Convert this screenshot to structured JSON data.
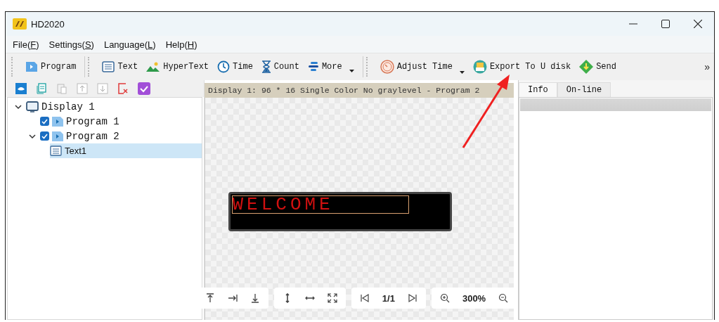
{
  "window": {
    "title": "HD2020"
  },
  "menu": [
    {
      "before": "File(",
      "key": "F",
      "after": ")"
    },
    {
      "before": "Settings(",
      "key": "S",
      "after": ")"
    },
    {
      "before": "Language(",
      "key": "L",
      "after": ")"
    },
    {
      "before": "Help(",
      "key": "H",
      "after": ")"
    }
  ],
  "toolbar": {
    "items": [
      {
        "kind": "program",
        "label": "Program",
        "dropdown": false,
        "group_start": false
      },
      {
        "kind": "text",
        "label": "Text",
        "dropdown": false,
        "group_start": true
      },
      {
        "kind": "hypertext",
        "label": "HyperText",
        "dropdown": false,
        "group_start": false
      },
      {
        "kind": "time",
        "label": "Time",
        "dropdown": false,
        "group_start": false
      },
      {
        "kind": "count",
        "label": "Count",
        "dropdown": false,
        "group_start": false
      },
      {
        "kind": "more",
        "label": "More",
        "dropdown": true,
        "group_start": false
      },
      {
        "kind": "adjust",
        "label": "Adjust Time",
        "dropdown": true,
        "group_start": true
      },
      {
        "kind": "export",
        "label": "Export To U disk",
        "dropdown": false,
        "group_start": false
      },
      {
        "kind": "send",
        "label": "Send",
        "dropdown": false,
        "group_start": false
      }
    ],
    "overflow": "»"
  },
  "tree_toolbar": [
    {
      "kind": "display",
      "disabled": false
    },
    {
      "kind": "copy",
      "disabled": false
    },
    {
      "kind": "paste",
      "disabled": true
    },
    {
      "kind": "up",
      "disabled": true
    },
    {
      "kind": "down",
      "disabled": true
    },
    {
      "kind": "delete",
      "disabled": false
    },
    {
      "kind": "check",
      "disabled": false
    }
  ],
  "tree": [
    {
      "kind": "display",
      "label": "Display 1",
      "expanded": true,
      "selected": false,
      "children": [
        {
          "kind": "program",
          "label": "Program 1",
          "checked": true,
          "selected": false
        },
        {
          "kind": "program",
          "label": "Program 2",
          "checked": true,
          "expanded": true,
          "selected": false,
          "children": [
            {
              "kind": "text",
              "label": "Text1",
              "selected": true
            }
          ]
        }
      ]
    }
  ],
  "canvas": {
    "header": "Display 1: 96 * 16 Single Color No graylevel - Program 2",
    "led_text": "WELCOME",
    "control_groups": [
      {
        "controls": [
          {
            "kind": "align-top"
          },
          {
            "kind": "align-right"
          },
          {
            "kind": "align-bottom"
          }
        ]
      },
      {
        "controls": [
          {
            "kind": "fit-height"
          },
          {
            "kind": "fit-width"
          },
          {
            "kind": "fit-all"
          }
        ]
      },
      {
        "controls": [
          {
            "kind": "first"
          },
          {
            "kind": "page",
            "label": "1/1"
          },
          {
            "kind": "last"
          }
        ]
      },
      {
        "controls": [
          {
            "kind": "zoom-in"
          },
          {
            "kind": "zoom",
            "label": "300%"
          },
          {
            "kind": "zoom-out"
          }
        ]
      }
    ]
  },
  "right_panel": {
    "tabs": [
      {
        "label": "Info",
        "selected": true
      },
      {
        "label": "On-line",
        "selected": false
      }
    ]
  }
}
